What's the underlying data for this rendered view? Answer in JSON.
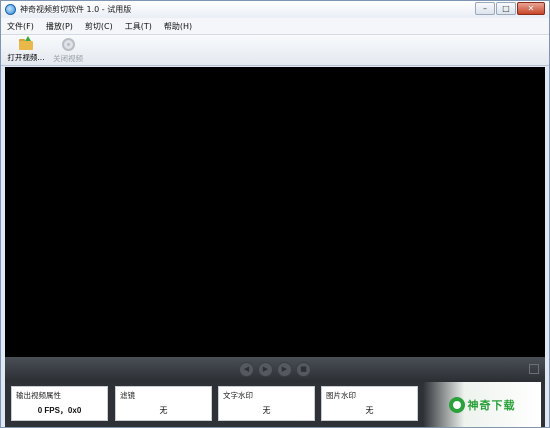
{
  "window": {
    "title": "神奇视频剪切软件 1.0 - 试用版",
    "controls": {
      "minimize": "–",
      "maximize": "□",
      "close": "✕"
    }
  },
  "menu": {
    "items": [
      {
        "label": "文件(F)"
      },
      {
        "label": "播放(P)"
      },
      {
        "label": "剪切(C)"
      },
      {
        "label": "工具(T)"
      },
      {
        "label": "帮助(H)"
      }
    ]
  },
  "toolbar": {
    "open_label": "打开视频...",
    "open_icon": "folder-open-icon",
    "close_label": "关闭视频",
    "close_icon": "disc-icon",
    "close_enabled": false
  },
  "player": {
    "controls": [
      {
        "icon": "previous-icon",
        "glyph": "◀"
      },
      {
        "icon": "play-icon",
        "glyph": "▶"
      },
      {
        "icon": "next-icon",
        "glyph": "▶"
      },
      {
        "icon": "stop-icon",
        "glyph": "■"
      }
    ]
  },
  "panels": {
    "output": {
      "title": "输出视频属性",
      "value": "0 FPS，0x0"
    },
    "filter": {
      "title": "滤镜",
      "value": "无"
    },
    "text_watermark": {
      "title": "文字水印",
      "value": "无"
    },
    "image_watermark": {
      "title": "图片水印",
      "value": "无"
    }
  },
  "watermark": {
    "text": "神奇下载"
  },
  "colors": {
    "video_bg": "#000000",
    "brand_green": "#2aa13b"
  }
}
